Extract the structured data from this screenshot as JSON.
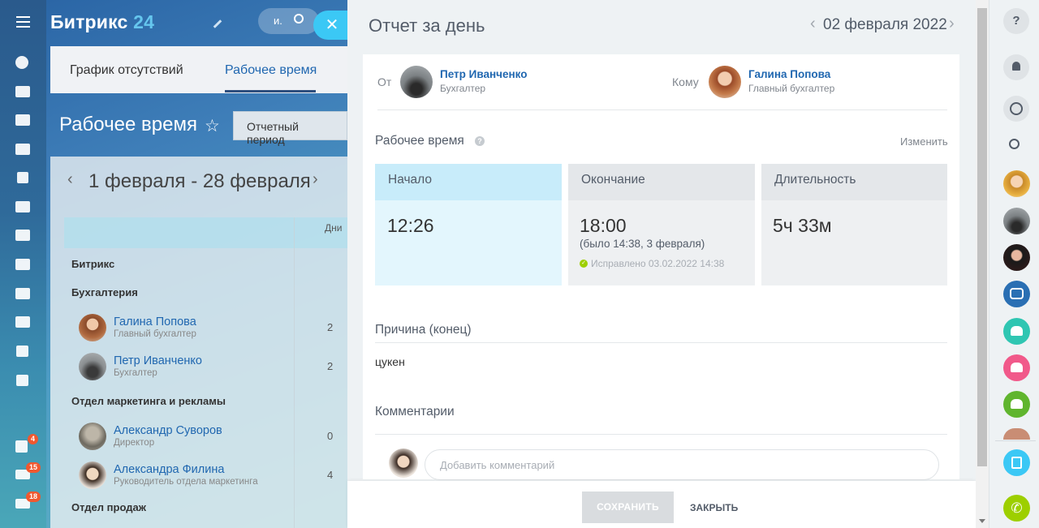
{
  "app": {
    "logo_main": "Битрикс",
    "logo_num": "24",
    "search_placeholder": "и."
  },
  "left_rail": {
    "badges": [
      "4",
      "15",
      "18"
    ]
  },
  "background": {
    "tabs": [
      "График отсутствий",
      "Рабочее время"
    ],
    "title": "Рабочее время",
    "period_button": "Отчетный период",
    "date_range": "1 февраля - 28 февраля",
    "col_header": "Дни",
    "groups": [
      {
        "label": "Битрикс"
      },
      {
        "label": "Бухгалтерия"
      },
      {
        "label": "Отдел маркетинга и рекламы"
      },
      {
        "label": "Отдел продаж"
      }
    ],
    "people": [
      {
        "name": "Галина Попова",
        "position": "Главный бухгалтер",
        "days": "2"
      },
      {
        "name": "Петр Иванченко",
        "position": "Бухгалтер",
        "days": "2"
      },
      {
        "name": "Александр Суворов",
        "position": "Директор",
        "days": "0"
      },
      {
        "name": "Александра Филина",
        "position": "Руководитель отдела маркетинга",
        "days": "4"
      }
    ]
  },
  "panel": {
    "title": "Отчет за день",
    "date": "02 февраля 2022",
    "from_label": "От",
    "to_label": "Кому",
    "from": {
      "name": "Петр Иванченко",
      "position": "Бухгалтер"
    },
    "to": {
      "name": "Галина Попова",
      "position": "Главный бухгалтер"
    },
    "worktime_title": "Рабочее время",
    "edit_link": "Изменить",
    "start": {
      "label": "Начало",
      "value": "12:26"
    },
    "end": {
      "label": "Окончание",
      "value": "18:00",
      "note": "(было 14:38, 3 февраля)",
      "fixed": "Исправлено 03.02.2022 14:38"
    },
    "duration": {
      "label": "Длительность",
      "value": "5ч 33м"
    },
    "reason_title": "Причина (конец)",
    "reason_text": "цукен",
    "comments_title": "Комментарии",
    "comment_placeholder": "Добавить комментарий",
    "save_button": "СОХРАНИТЬ",
    "close_button": "ЗАКРЫТЬ"
  },
  "colors": {
    "accent": "#3bc8f5",
    "link": "#2067b0",
    "start_box": "#e3f6fd",
    "start_head": "#c8ecfa",
    "grey_box": "#eef0f2"
  }
}
